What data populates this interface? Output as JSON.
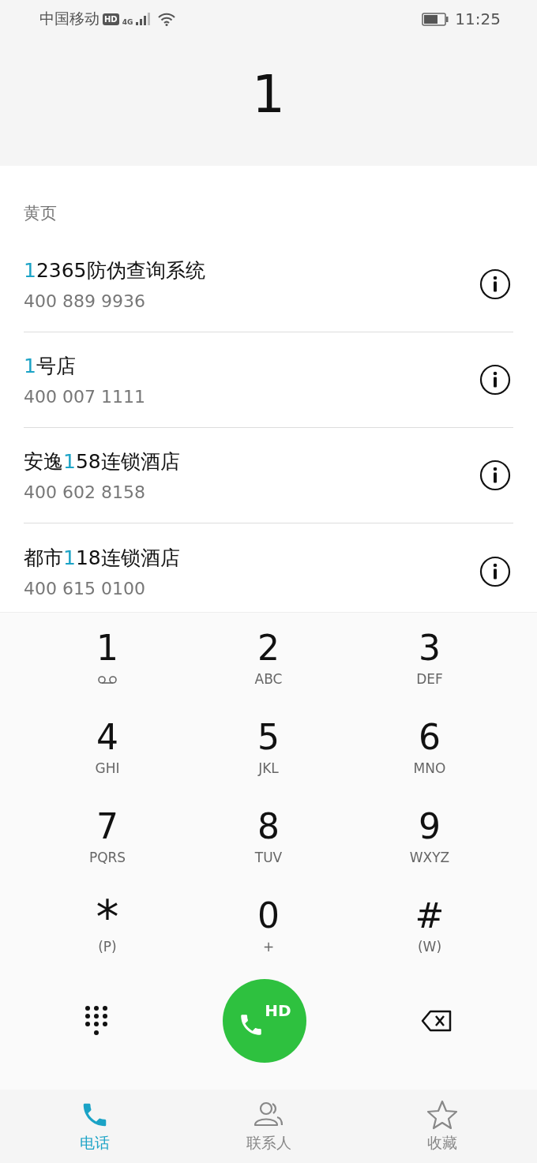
{
  "status_bar": {
    "carrier": "中国移动",
    "hd": "HD",
    "network": "4G",
    "time": "11:25"
  },
  "display": {
    "number": "1"
  },
  "section": {
    "title": "黄页"
  },
  "results": [
    {
      "name": {
        "match": "1",
        "after": "2365防伪查询系统"
      },
      "number": "400 889 9936"
    },
    {
      "name": {
        "match": "1",
        "after": "号店"
      },
      "number": "400 007 1111"
    },
    {
      "name": {
        "before": "安逸",
        "match": "1",
        "after": "58连锁酒店"
      },
      "number": "400 602 8158"
    },
    {
      "name": {
        "before": "都市",
        "match": "1",
        "after": "18连锁酒店"
      },
      "number": "400 615 0100"
    }
  ],
  "keypad": [
    {
      "digit": "1",
      "kind": "voicemail"
    },
    {
      "digit": "2",
      "letters": "ABC",
      "kind": "text"
    },
    {
      "digit": "3",
      "letters": "DEF",
      "kind": "text"
    },
    {
      "digit": "4",
      "letters": "GHI",
      "kind": "text"
    },
    {
      "digit": "5",
      "letters": "JKL",
      "kind": "text"
    },
    {
      "digit": "6",
      "letters": "MNO",
      "kind": "text"
    },
    {
      "digit": "7",
      "letters": "PQRS",
      "kind": "text"
    },
    {
      "digit": "8",
      "letters": "TUV",
      "kind": "text"
    },
    {
      "digit": "9",
      "letters": "WXYZ",
      "kind": "text"
    },
    {
      "digit": "*",
      "letters": "(P)",
      "kind": "text"
    },
    {
      "digit": "0",
      "letters": "+",
      "kind": "text"
    },
    {
      "digit": "#",
      "letters": "(W)",
      "kind": "text"
    }
  ],
  "call_button": {
    "badge": "HD"
  },
  "tabs": [
    {
      "label": "电话",
      "kind": "phone",
      "selected": true
    },
    {
      "label": "联系人",
      "kind": "contacts",
      "selected": false
    },
    {
      "label": "收藏",
      "kind": "favorites",
      "selected": false
    }
  ]
}
